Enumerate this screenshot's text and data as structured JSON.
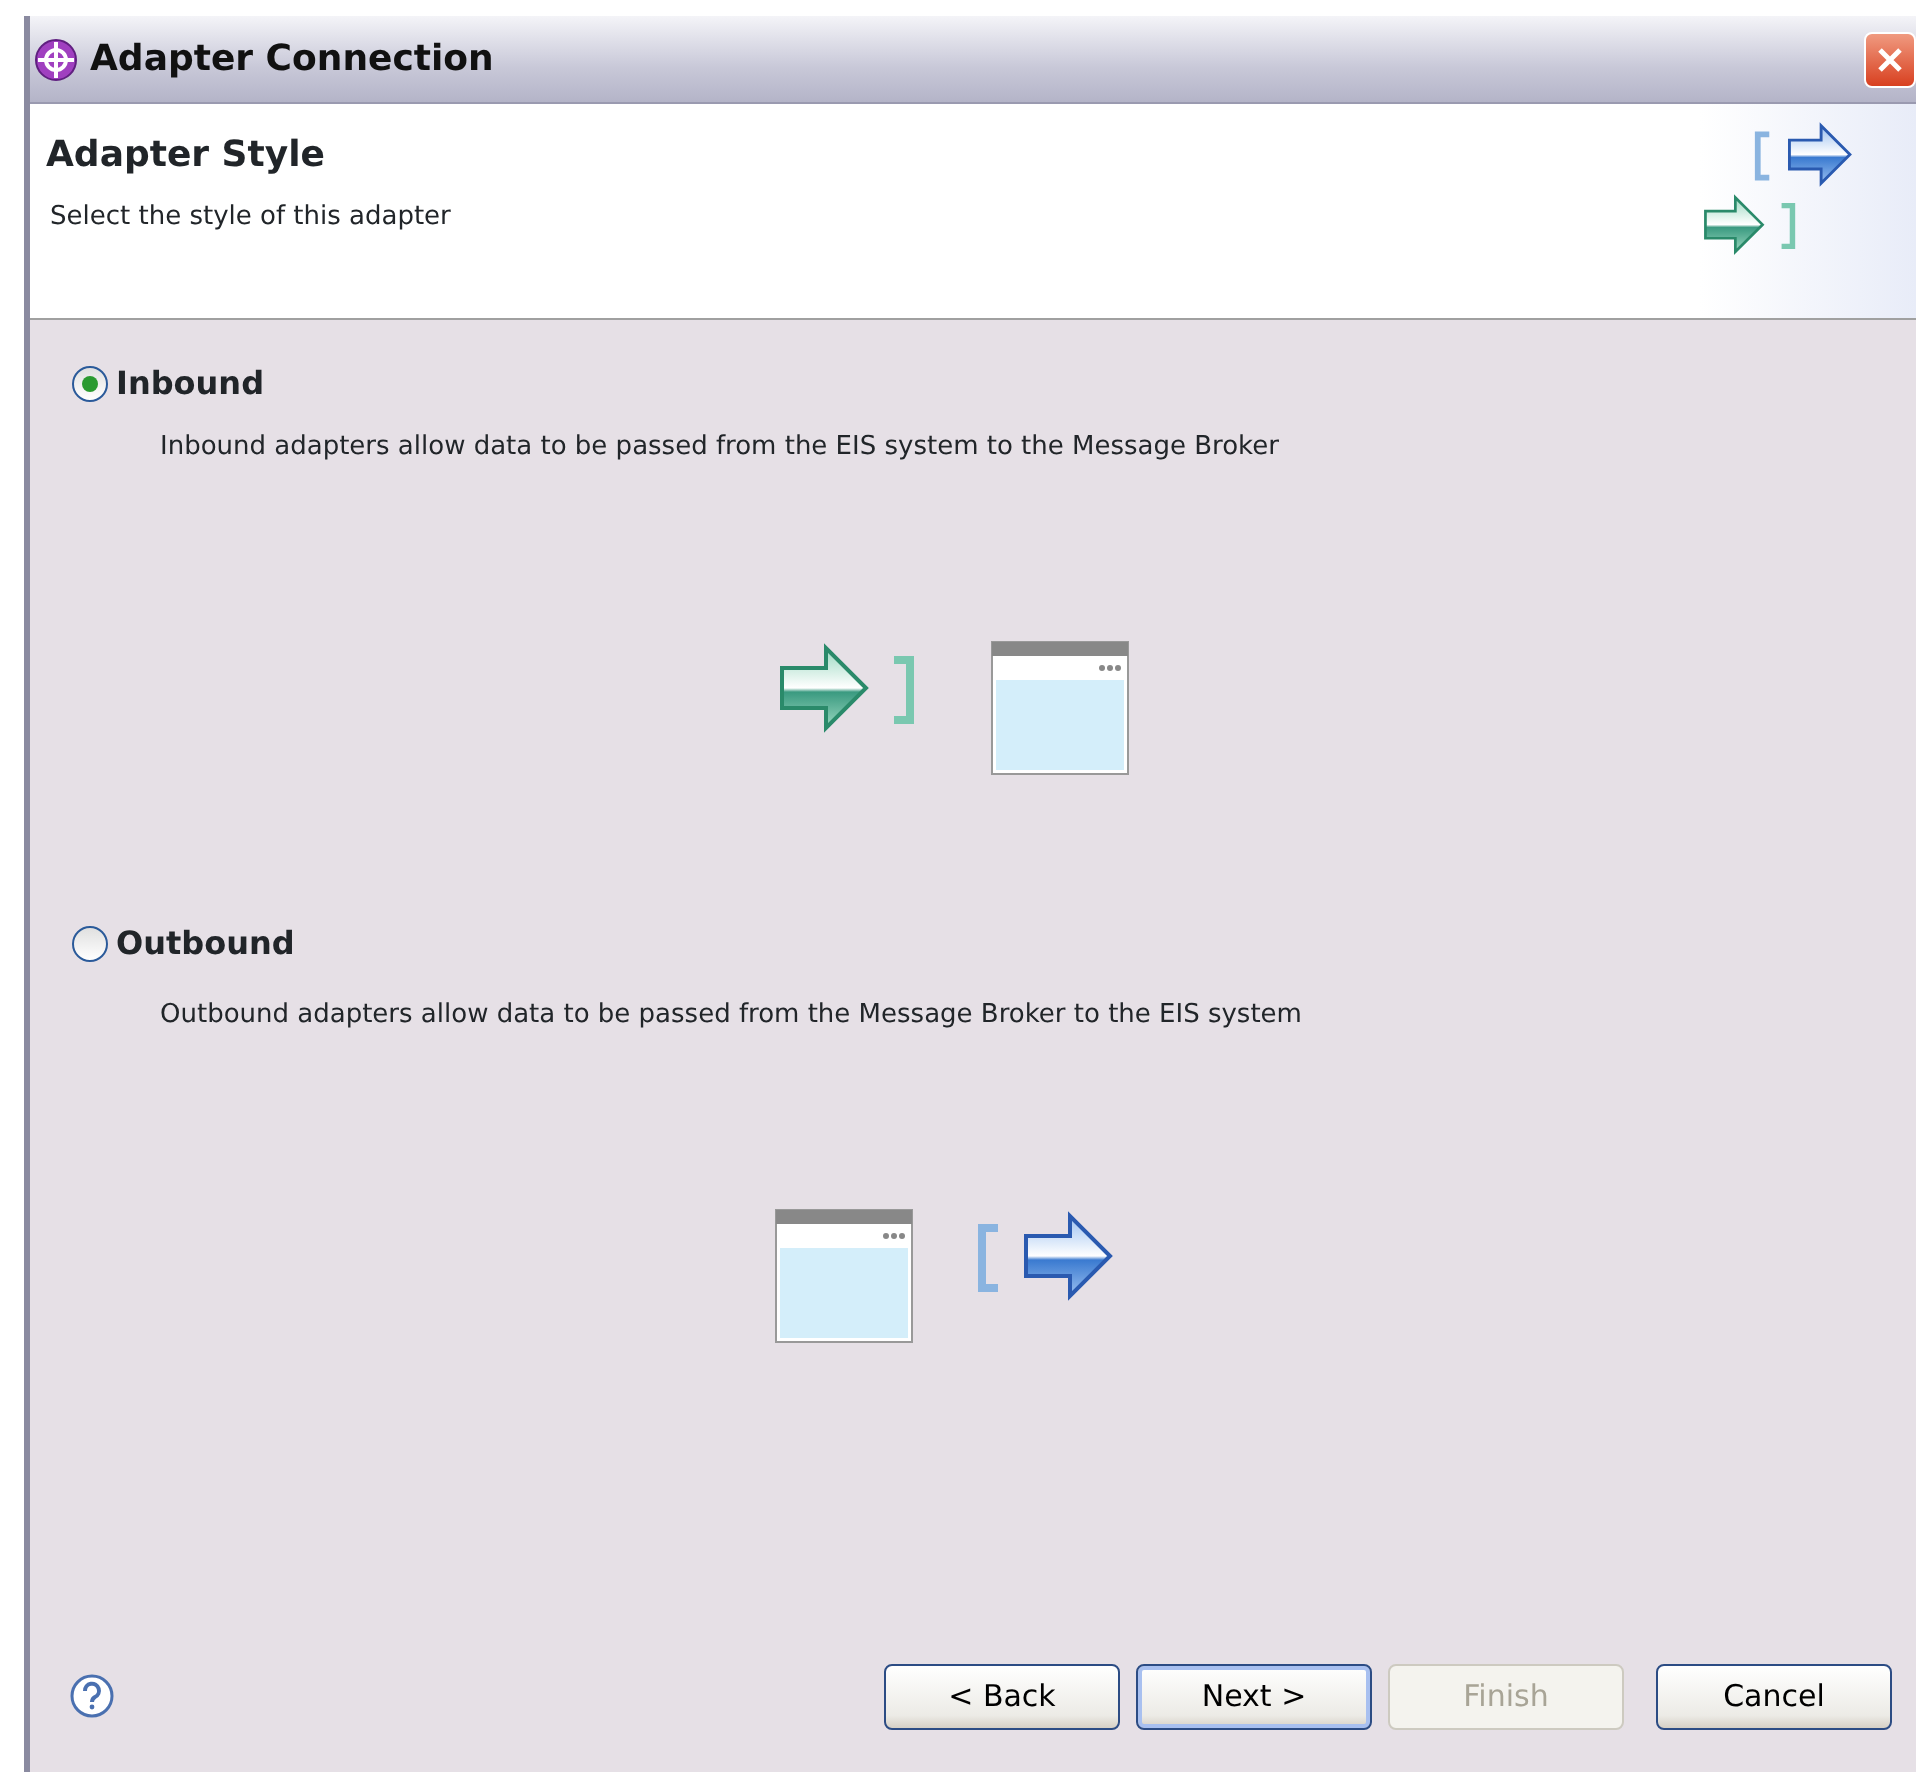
{
  "window": {
    "title": "Adapter Connection"
  },
  "header": {
    "title": "Adapter Style",
    "description": "Select the style of this adapter"
  },
  "options": [
    {
      "kind": "inbound",
      "label": "Inbound",
      "description": "Inbound adapters allow data to be passed from the EIS system to the Message Broker",
      "selected": true
    },
    {
      "kind": "outbound",
      "label": "Outbound",
      "description": "Outbound adapters allow data to be passed from the Message Broker to the EIS system",
      "selected": false
    }
  ],
  "buttons": [
    {
      "label": "< Back",
      "disabled": false,
      "default": false
    },
    {
      "label": "Next >",
      "disabled": false,
      "default": true
    },
    {
      "label": "Finish",
      "disabled": true,
      "default": false
    },
    {
      "label": "Cancel",
      "disabled": false,
      "default": false
    }
  ]
}
